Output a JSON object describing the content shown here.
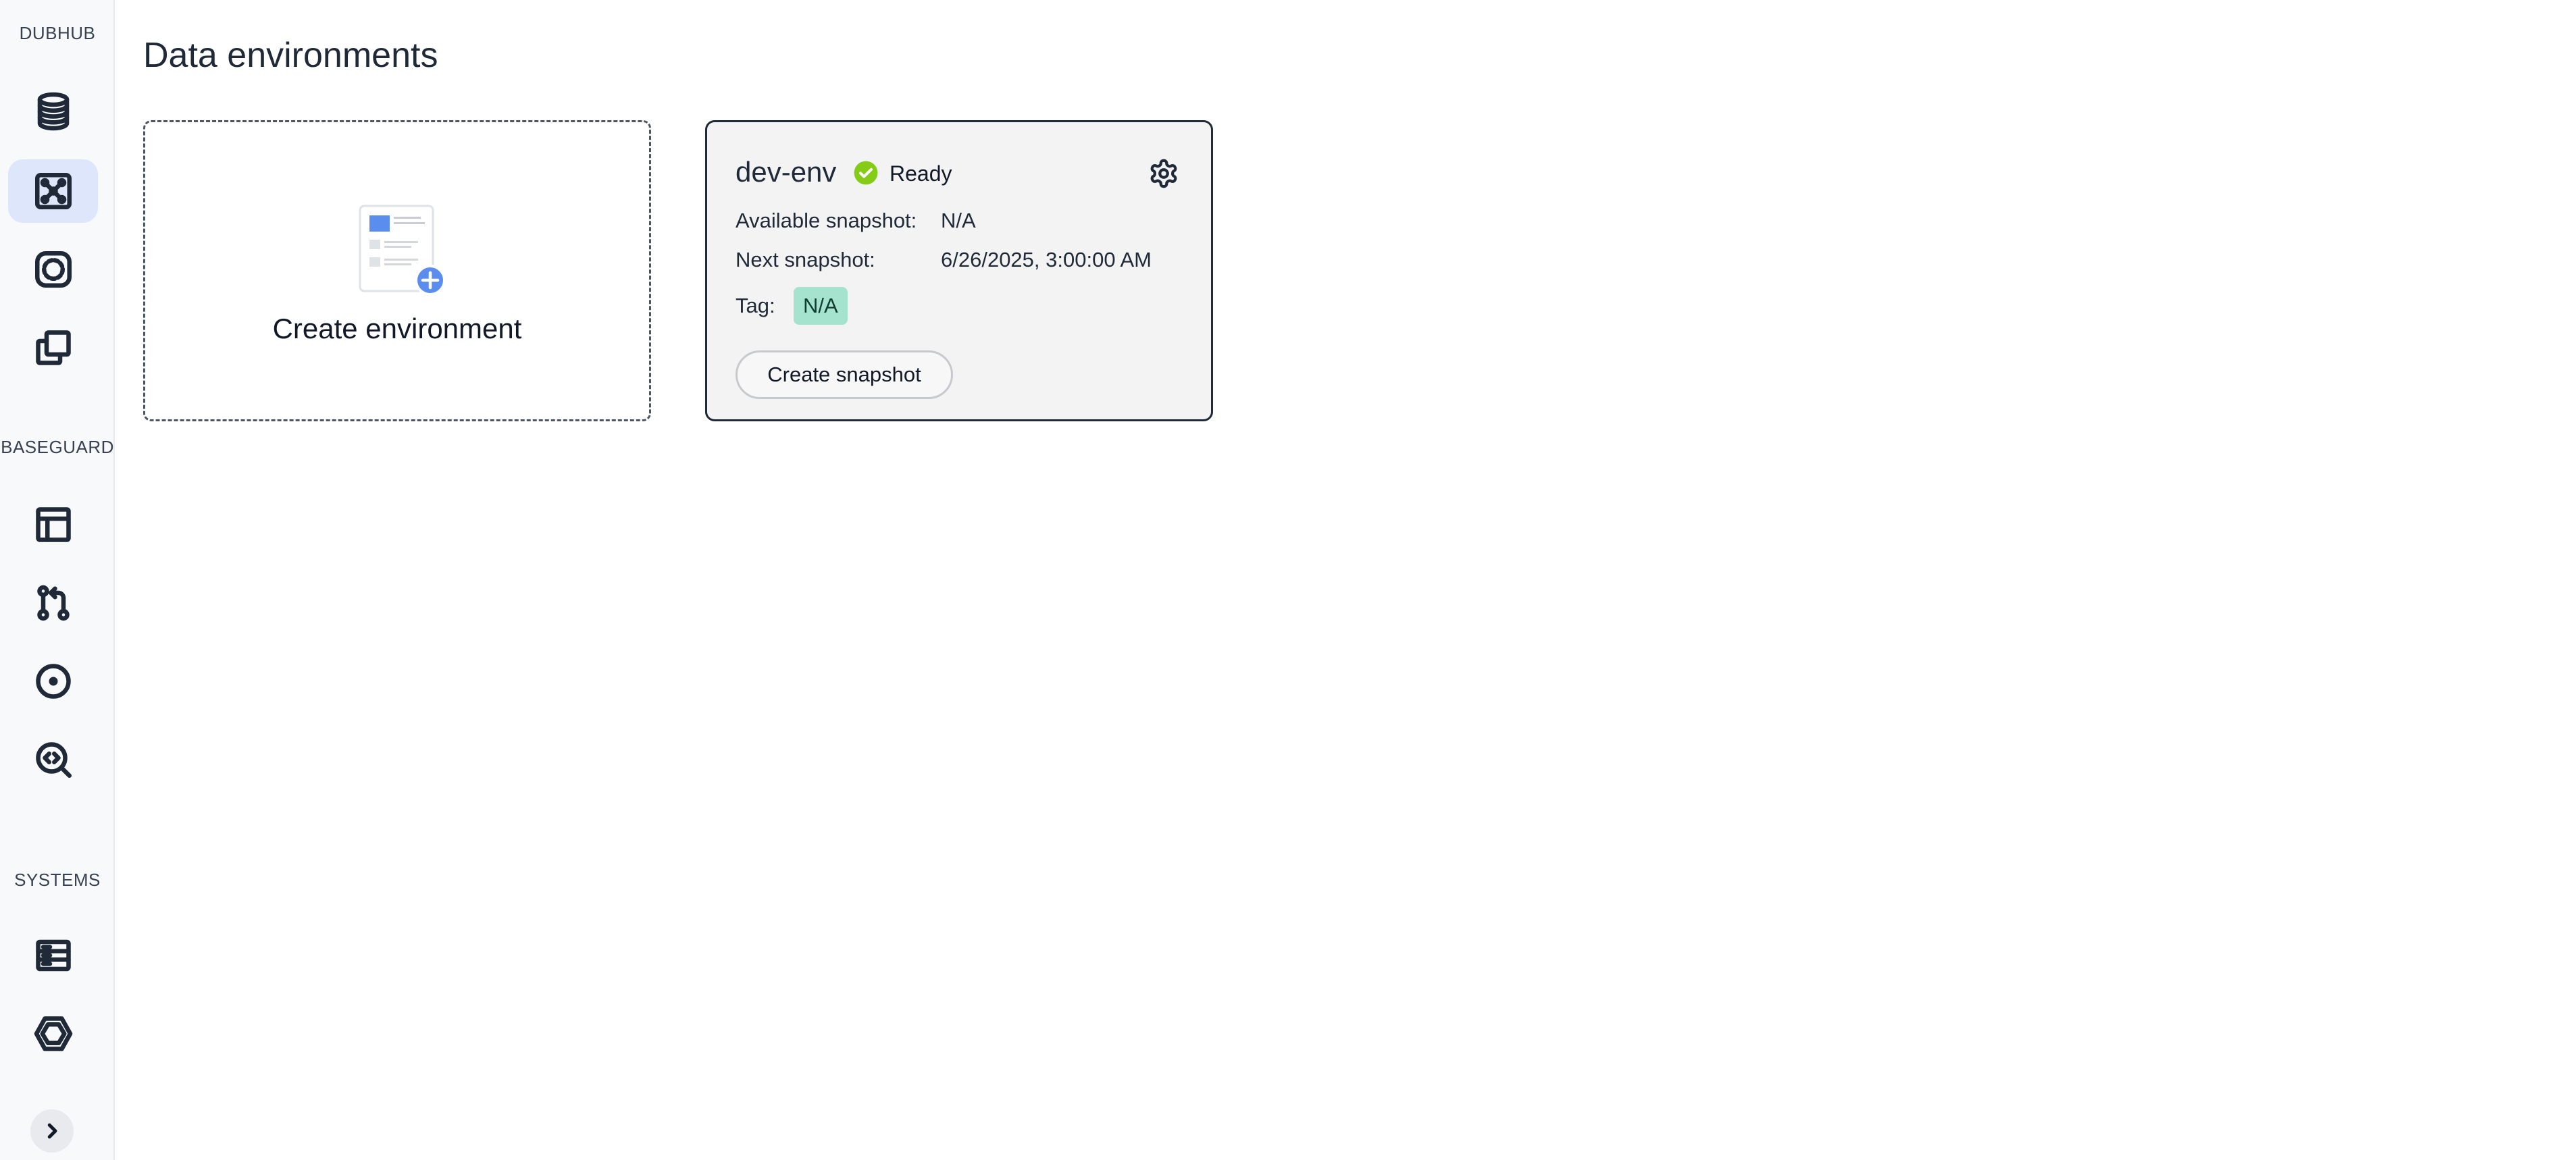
{
  "sidebar": {
    "sections": [
      {
        "label": "DUBHUB"
      },
      {
        "label": "BASEGUARD"
      },
      {
        "label": "SYSTEMS"
      }
    ],
    "items": [
      {
        "icon": "database-icon",
        "active": false
      },
      {
        "icon": "network-graph-icon",
        "active": true
      },
      {
        "icon": "dashed-circle-icon",
        "active": false
      },
      {
        "icon": "copy-icon",
        "active": false
      },
      {
        "icon": "table-layout-icon",
        "active": false
      },
      {
        "icon": "git-pull-request-icon",
        "active": false
      },
      {
        "icon": "circle-dot-icon",
        "active": false
      },
      {
        "icon": "code-search-icon",
        "active": false
      },
      {
        "icon": "server-list-icon",
        "active": false
      },
      {
        "icon": "hexagon-icon",
        "active": false
      }
    ],
    "collapse_icon": "chevron-right-icon"
  },
  "main": {
    "title": "Data environments",
    "create_card": {
      "label": "Create environment",
      "icon": "add-document-icon"
    },
    "environments": [
      {
        "name": "dev-env",
        "status": "Ready",
        "status_color": "#84cc16",
        "available_snapshot_label": "Available snapshot:",
        "available_snapshot_value": "N/A",
        "next_snapshot_label": "Next snapshot:",
        "next_snapshot_value": "6/26/2025, 3:00:00 AM",
        "tag_label": "Tag:",
        "tag_value": "N/A",
        "tag_color": "#a6e3cf",
        "action_label": "Create snapshot"
      }
    ]
  },
  "colors": {
    "accent": "#5b8def",
    "active_nav_bg": "#dde6fb"
  }
}
